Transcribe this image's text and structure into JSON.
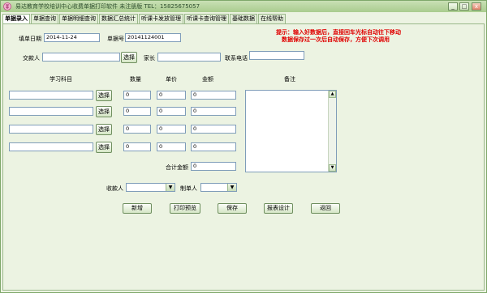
{
  "window": {
    "title": "易达教育学校培训中心收费单据打印软件 未注册版   TEL：15825675057",
    "minimize": "_",
    "maximize": "□",
    "close": "x"
  },
  "tabs": [
    "单据录入",
    "单据查询",
    "单据明细查询",
    "数据汇总统计",
    "听课卡发放管理",
    "听课卡查询管理",
    "基础数据",
    "在线帮助"
  ],
  "form": {
    "fill_date_label": "填单日期",
    "fill_date_value": "2014-11-24",
    "bill_no_label": "单据号",
    "bill_no_value": "20141124001",
    "payer_label": "交款人",
    "payer_value": "",
    "select_label": "选择",
    "parent_label": "家长",
    "parent_value": "",
    "phone_label": "联系电话",
    "phone_value": ""
  },
  "hint": {
    "line1": "提示：输入好数据后，直接回车光标自动往下移动",
    "line2": "数据保存过一次后自动保存，方便下次调用"
  },
  "items": {
    "headers": {
      "subject": "学习科目",
      "quantity": "数量",
      "price": "单价",
      "amount": "金额",
      "notes": "备注"
    },
    "rows": [
      {
        "subject": "",
        "select": "选择",
        "quantity": "0",
        "price": "0",
        "amount": "0"
      },
      {
        "subject": "",
        "select": "选择",
        "quantity": "0",
        "price": "0",
        "amount": "0"
      },
      {
        "subject": "",
        "select": "选择",
        "quantity": "0",
        "price": "0",
        "amount": "0"
      },
      {
        "subject": "",
        "select": "选择",
        "quantity": "0",
        "price": "0",
        "amount": "0"
      }
    ]
  },
  "total": {
    "label": "合计金额",
    "value": "0"
  },
  "people": {
    "receiver_label": "收款人",
    "receiver_value": "",
    "maker_label": "制单人",
    "maker_value": ""
  },
  "actions": {
    "new": "新增",
    "print_preview": "打印预览",
    "save": "保存",
    "report_design": "报表设计",
    "back": "返回"
  }
}
